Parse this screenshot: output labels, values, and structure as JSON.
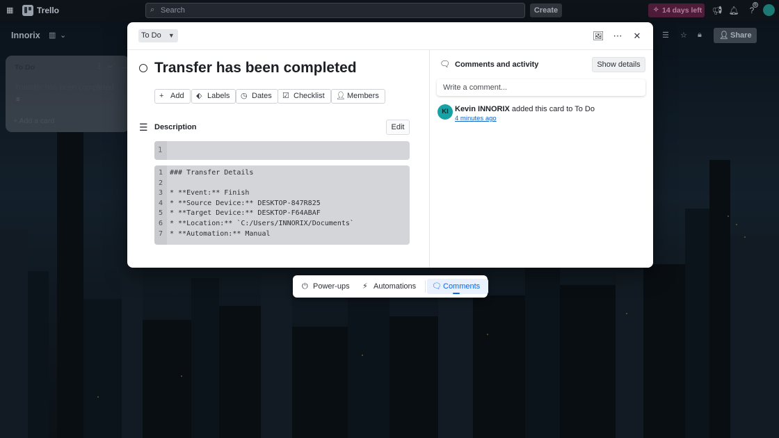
{
  "topbar": {
    "app_name": "Trello",
    "search_placeholder": "Search",
    "create_label": "Create",
    "trial_label": "14 days left",
    "notification_badge": "6"
  },
  "board": {
    "title": "Innorix",
    "share_label": "Share",
    "list": {
      "title": "To Do",
      "card_title": "Transfer has been completed",
      "add_card_label": "Add a card"
    }
  },
  "modal": {
    "list_name": "To Do",
    "card_title": "Transfer has been completed",
    "actions": [
      "Add",
      "Labels",
      "Dates",
      "Checklist",
      "Members"
    ],
    "description_label": "Description",
    "edit_label": "Edit",
    "code_block_1": {
      "lines": [
        {
          "n": "1",
          "text": ""
        }
      ]
    },
    "code_block_2": {
      "lines": [
        {
          "n": "1",
          "text": "### Transfer Details"
        },
        {
          "n": "2",
          "text": ""
        },
        {
          "n": "3",
          "text": "* **Event:** Finish"
        },
        {
          "n": "4",
          "text": "* **Source Device:** DESKTOP-847R825"
        },
        {
          "n": "5",
          "text": "* **Target Device:** DESKTOP-F64ABAF"
        },
        {
          "n": "6",
          "text": "* **Location:** `C:/Users/INNORIX/Documents`"
        },
        {
          "n": "7",
          "text": "* **Automation:** Manual"
        }
      ]
    },
    "comments": {
      "heading": "Comments and activity",
      "show_details_label": "Show details",
      "input_placeholder": "Write a comment...",
      "activity": {
        "avatar_initials": "KI",
        "user": "Kevin INNORIX",
        "action_text": " added this card to To Do",
        "time": "4 minutes ago"
      }
    }
  },
  "bottom_bar": {
    "powerups_label": "Power-ups",
    "automations_label": "Automations",
    "comments_label": "Comments"
  },
  "colors": {
    "accent": "#0c66e4",
    "avatar": "#17a3a5",
    "trial_badge": "#8c285a"
  }
}
